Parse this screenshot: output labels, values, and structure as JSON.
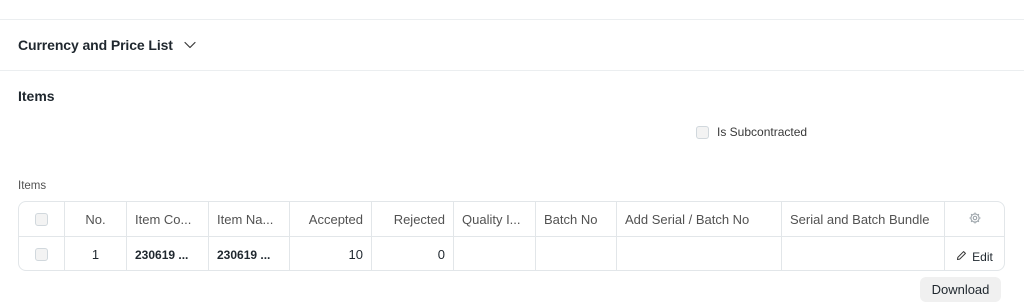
{
  "currency_section": {
    "title": "Currency and Price List"
  },
  "items_section": {
    "title": "Items"
  },
  "subcontracted": {
    "label": "Is Subcontracted",
    "checked": false
  },
  "grid": {
    "label": "Items",
    "columns": {
      "no": "No.",
      "item_code": "Item Co...",
      "item_name": "Item Na...",
      "accepted": "Accepted",
      "rejected": "Rejected",
      "quality_inspection": "Quality I...",
      "batch_no": "Batch No",
      "add_serial_batch": "Add Serial / Batch No",
      "serial_batch_bundle": "Serial and Batch Bundle"
    },
    "rows": [
      {
        "no": "1",
        "item_code": "230619 ...",
        "item_name": "230619 ...",
        "accepted": "10",
        "rejected": "0",
        "quality_inspection": "",
        "batch_no": "",
        "add_serial_batch": "",
        "serial_batch_bundle": "",
        "edit_label": "Edit"
      }
    ],
    "settings_icon": "gear-icon"
  },
  "download": {
    "label": "Download"
  },
  "colors": {
    "text": "#1f272e",
    "muted": "#525252",
    "border": "#e2e6e9",
    "button_bg": "#f0f0f0"
  }
}
